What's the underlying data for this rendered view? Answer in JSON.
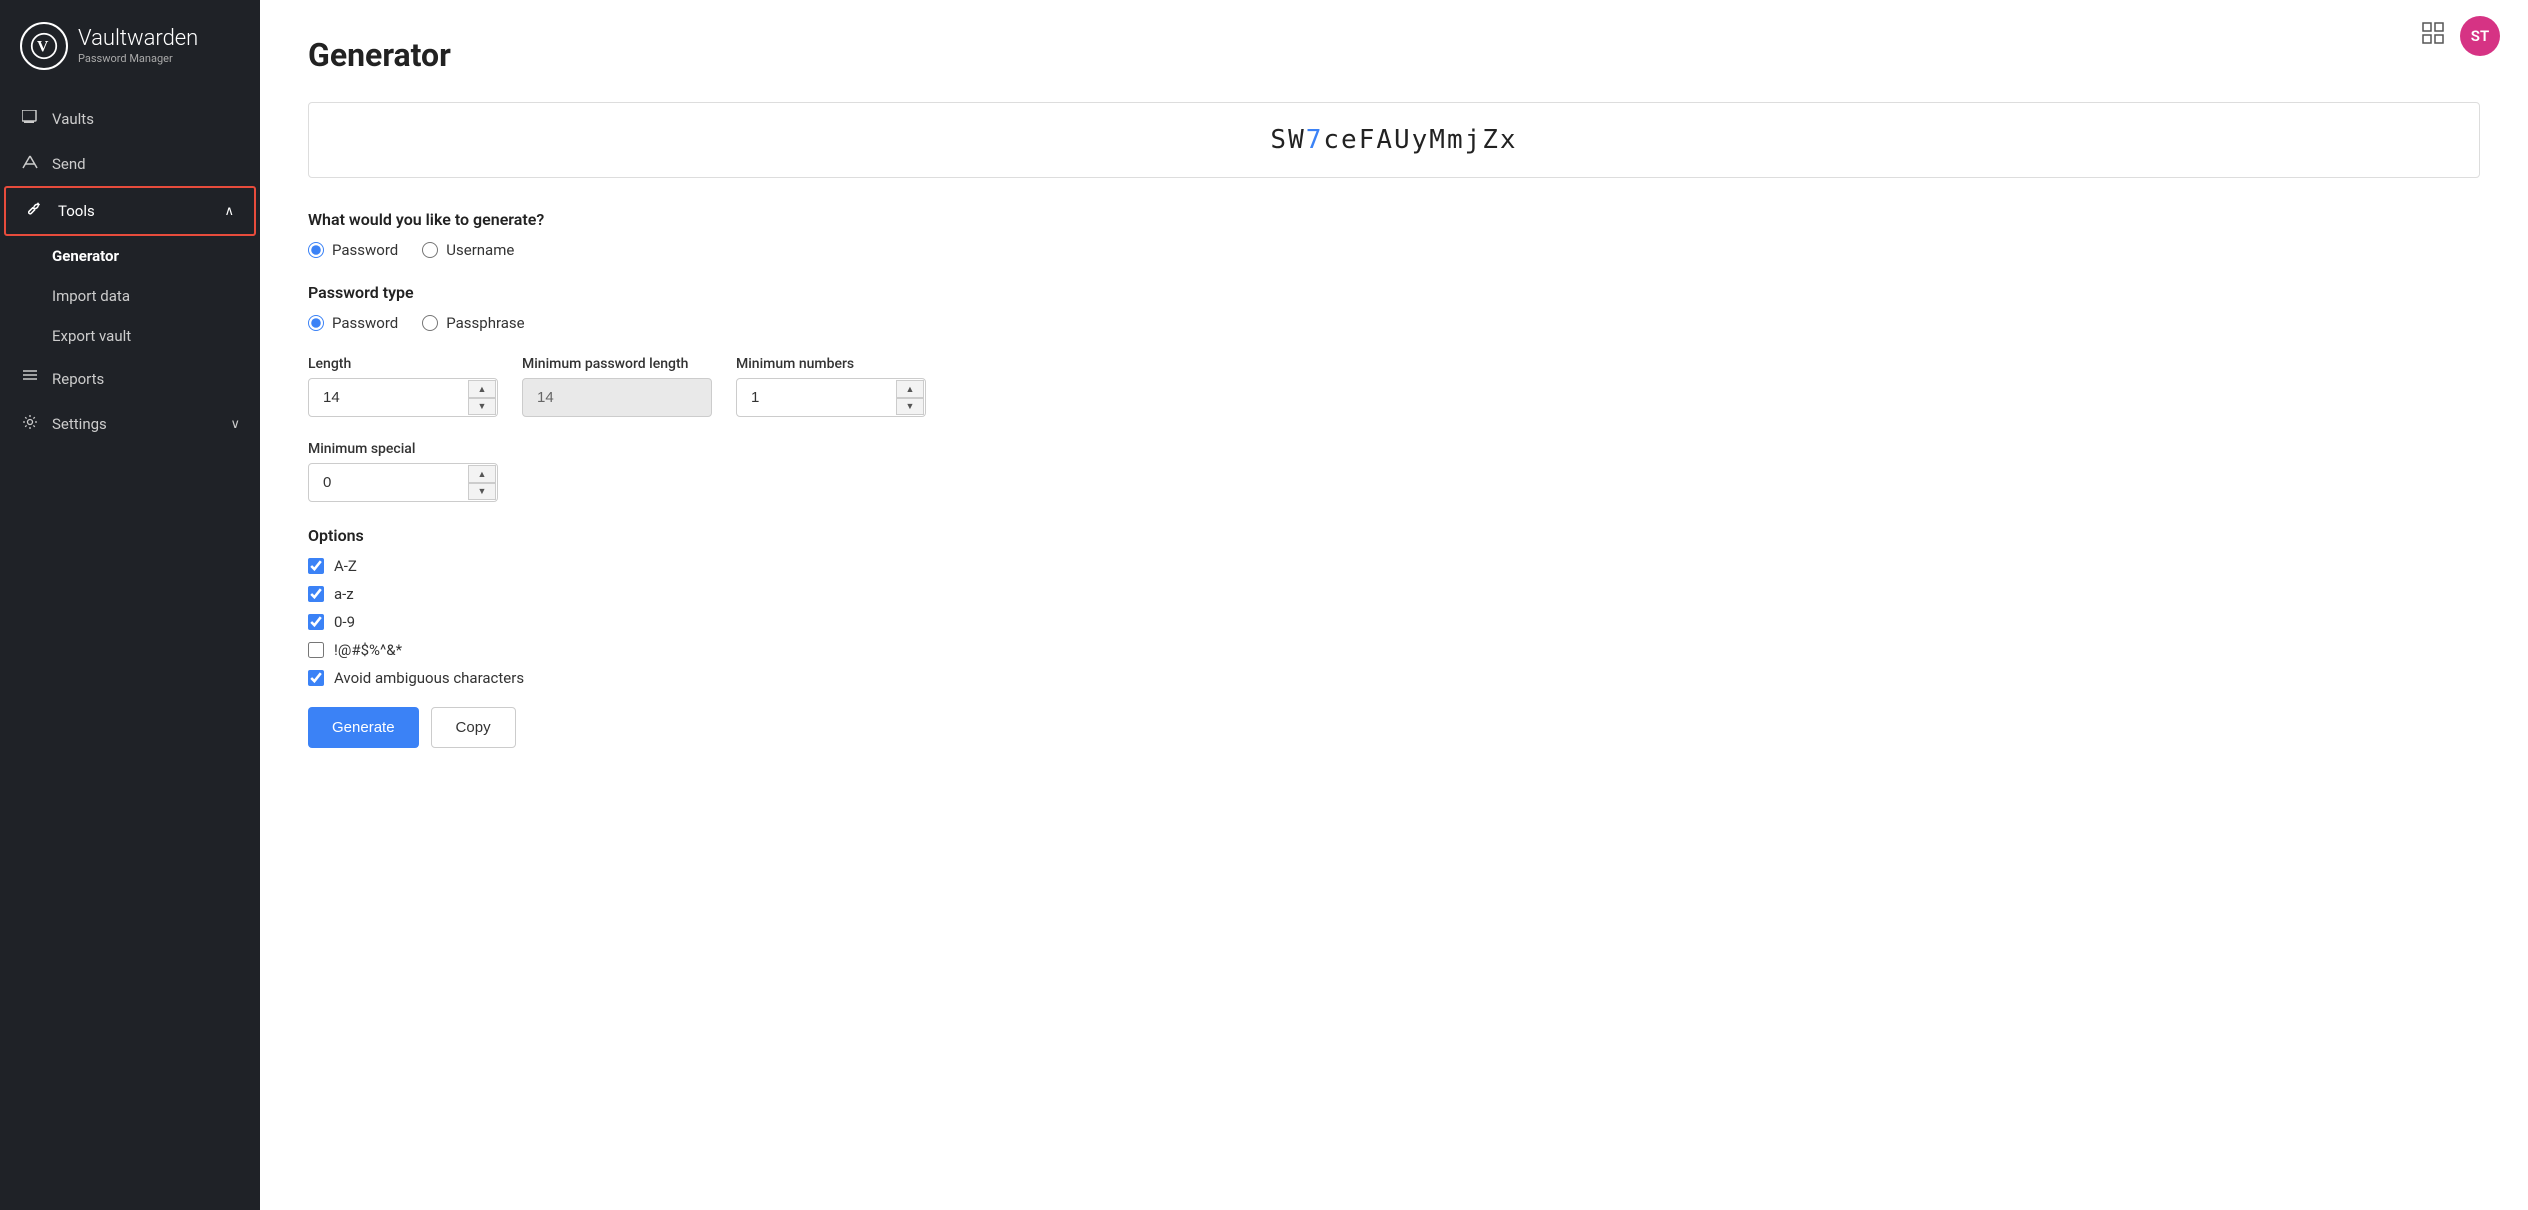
{
  "app": {
    "title": "Vaultwarden",
    "subtitle": "Password Manager",
    "logo_letter": "V",
    "avatar_initials": "ST"
  },
  "sidebar": {
    "items": [
      {
        "id": "vaults",
        "label": "Vaults",
        "icon": "🗔",
        "active": false,
        "sub": []
      },
      {
        "id": "send",
        "label": "Send",
        "icon": "✈",
        "active": false,
        "sub": []
      },
      {
        "id": "tools",
        "label": "Tools",
        "icon": "🔧",
        "active": true,
        "expanded": true,
        "sub": [
          {
            "id": "generator",
            "label": "Generator",
            "active": true
          },
          {
            "id": "import",
            "label": "Import data",
            "active": false
          },
          {
            "id": "export",
            "label": "Export vault",
            "active": false
          }
        ]
      },
      {
        "id": "reports",
        "label": "Reports",
        "icon": "☰",
        "active": false,
        "sub": []
      },
      {
        "id": "settings",
        "label": "Settings",
        "icon": "⚙",
        "active": false,
        "sub": []
      }
    ]
  },
  "main": {
    "page_title": "Generator",
    "generated_password": {
      "prefix": "SW",
      "highlight": "7",
      "suffix": "ceFAUyMmjZx"
    },
    "generate_question": "What would you like to generate?",
    "generate_options": [
      {
        "id": "password",
        "label": "Password",
        "checked": true
      },
      {
        "id": "username",
        "label": "Username",
        "checked": false
      }
    ],
    "password_type_label": "Password type",
    "password_type_options": [
      {
        "id": "password",
        "label": "Password",
        "checked": true
      },
      {
        "id": "passphrase",
        "label": "Passphrase",
        "checked": false
      }
    ],
    "fields": {
      "length": {
        "label": "Length",
        "value": "14"
      },
      "min_password_length": {
        "label": "Minimum password length",
        "value": "14",
        "readonly": true
      },
      "min_numbers": {
        "label": "Minimum numbers",
        "value": "1"
      },
      "min_special": {
        "label": "Minimum special",
        "value": "0"
      }
    },
    "options_label": "Options",
    "options": [
      {
        "id": "az_upper",
        "label": "A-Z",
        "checked": true
      },
      {
        "id": "az_lower",
        "label": "a-z",
        "checked": true
      },
      {
        "id": "digits",
        "label": "0-9",
        "checked": true
      },
      {
        "id": "special",
        "label": "!@#$%^&*",
        "checked": false
      },
      {
        "id": "avoid_ambiguous",
        "label": "Avoid ambiguous characters",
        "checked": true
      }
    ],
    "buttons": {
      "generate": "Generate",
      "copy": "Copy"
    }
  }
}
